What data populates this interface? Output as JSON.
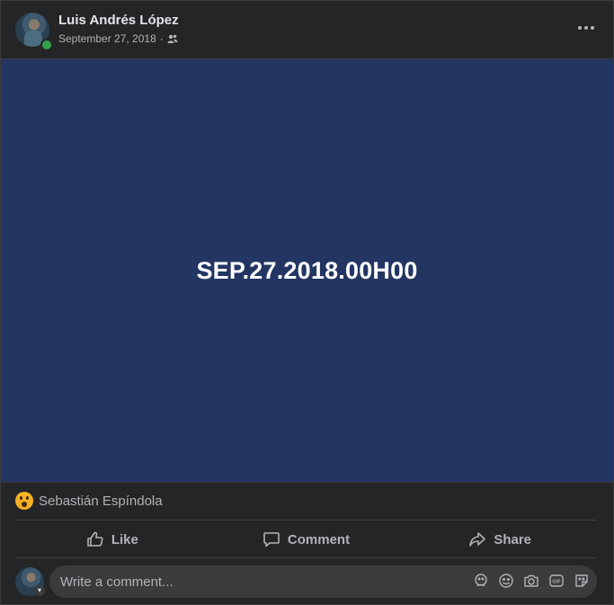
{
  "post": {
    "author": "Luis Andrés López",
    "date": "September 27, 2018",
    "separator": "·",
    "audience_icon": "friends-icon",
    "media_text": "SEP.27.2018.00H00",
    "media_bg": "#233562"
  },
  "reactions": {
    "emoji": "wow-icon",
    "names": "Sebastián Espíndola"
  },
  "actions": {
    "like": "Like",
    "comment": "Comment",
    "share": "Share"
  },
  "composer": {
    "placeholder": "Write a comment...",
    "tools": [
      "avatar-sticker-icon",
      "emoji-icon",
      "camera-icon",
      "gif-icon",
      "sticker-icon"
    ]
  }
}
